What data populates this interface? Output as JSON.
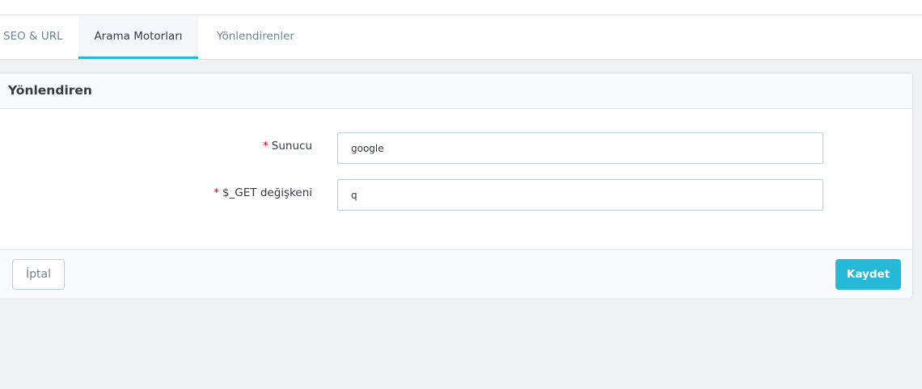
{
  "tabs": [
    {
      "label": "SEO & URL",
      "active": false
    },
    {
      "label": "Arama Motorları",
      "active": true
    },
    {
      "label": "Yönlendirenler",
      "active": false
    }
  ],
  "card": {
    "title": "Yönlendiren",
    "required_mark": "*",
    "fields": [
      {
        "label": "Sunucu",
        "value": "google"
      },
      {
        "label": "$_GET değişkeni",
        "value": "q"
      }
    ],
    "cancel_label": "İptal",
    "save_label": "Kaydet"
  },
  "colors": {
    "accent": "#25b9d7",
    "required": "#e3000f",
    "background": "#eff1f2"
  }
}
